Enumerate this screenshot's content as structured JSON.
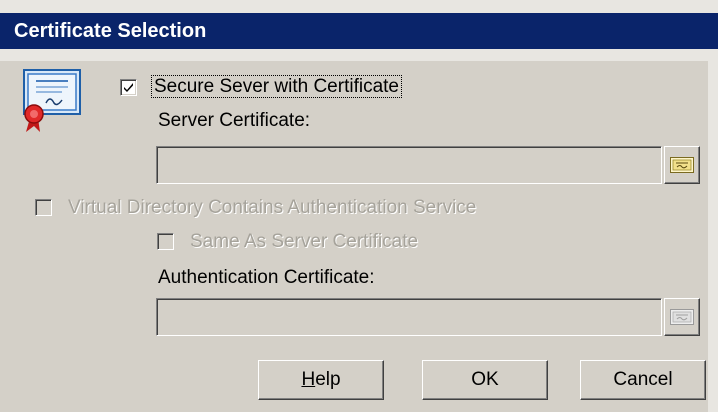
{
  "window": {
    "title": "Certificate Selection"
  },
  "secure_server": {
    "label": "Secure Sever with Certificate",
    "checked": true,
    "enabled": true
  },
  "server_certificate": {
    "label": "Server Certificate:",
    "value": "",
    "enabled": false
  },
  "virtual_directory": {
    "label": "Virtual Directory Contains Authentication Service",
    "checked": false,
    "enabled": false
  },
  "same_as_server": {
    "label": "Same As Server Certificate",
    "checked": false,
    "enabled": false
  },
  "auth_certificate": {
    "label": "Authentication Certificate:",
    "value": "",
    "enabled": false
  },
  "buttons": {
    "help": {
      "mnemonic": "H",
      "rest": "elp"
    },
    "ok": "OK",
    "cancel": "Cancel"
  },
  "icons": {
    "certificate": "certificate-icon",
    "browse": "browse-certificate-icon",
    "check": "checkmark-icon"
  },
  "colors": {
    "titlebar": "#0a246a",
    "dialog_face": "#d4d0c8",
    "disabled_text": "#a6a39b"
  }
}
